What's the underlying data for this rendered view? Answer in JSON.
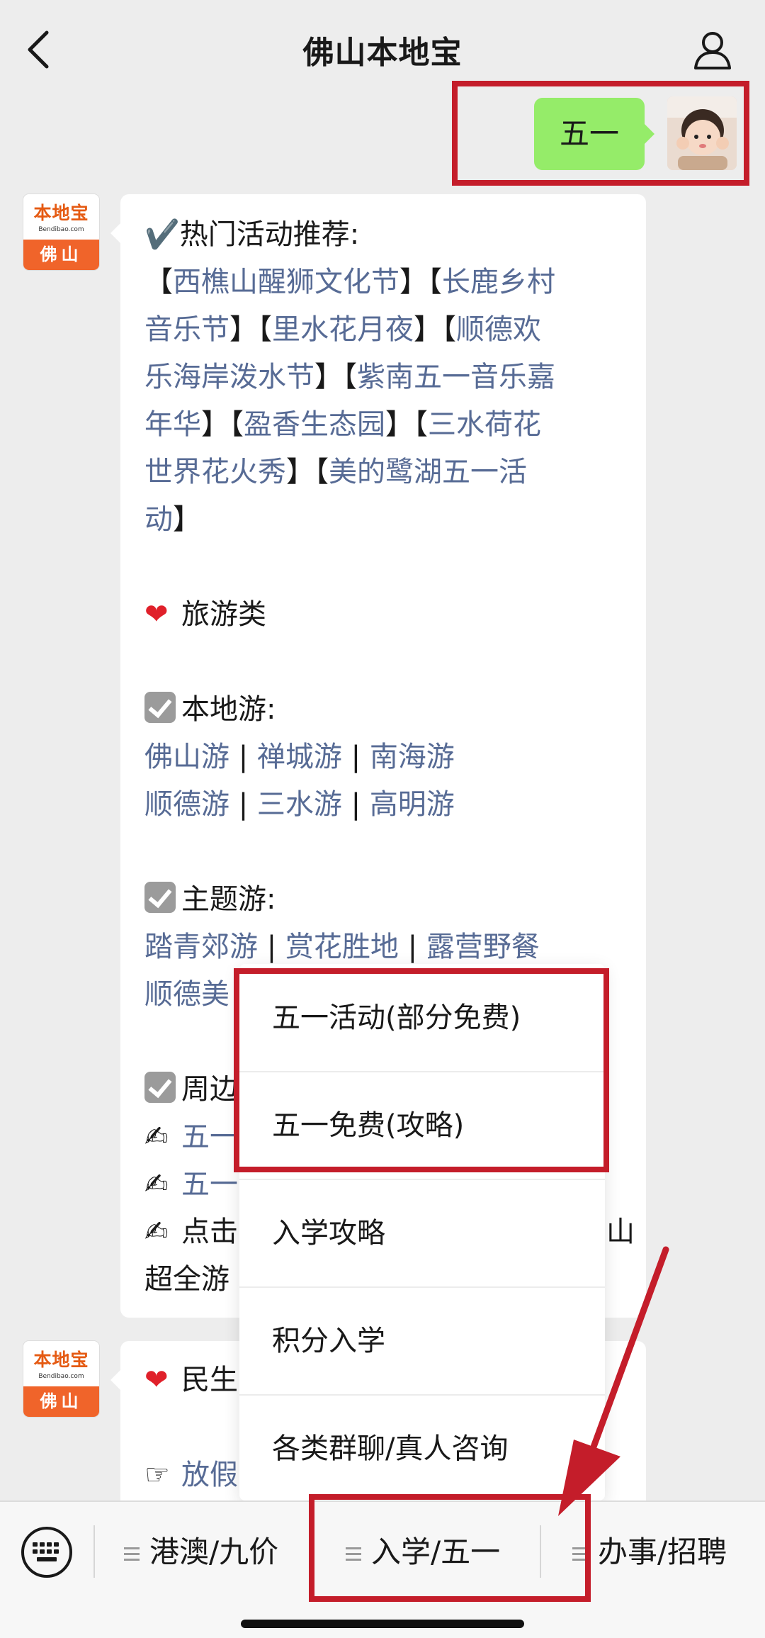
{
  "header": {
    "title": "佛山本地宝"
  },
  "outgoing": {
    "text": "五一"
  },
  "bot": {
    "brand": "本地宝",
    "domain": "Bendibao.com",
    "city": "佛山"
  },
  "message": {
    "hot_prefix": "✔️热门活动推荐:",
    "lines": [
      [
        "【",
        "西樵山醒狮文化节",
        "】【",
        "长鹿乡村"
      ],
      [
        "音乐节",
        "】【",
        "里水花月夜",
        "】【",
        "顺德欢"
      ],
      [
        "乐海岸泼水节",
        "】【",
        "紫南五一音乐嘉"
      ],
      [
        "年华",
        "】【",
        "盈香生态园",
        "】【",
        "三水荷花"
      ],
      [
        "世界花火秀",
        "】【",
        "美的鹭湖五一活"
      ],
      [
        "动",
        "】"
      ]
    ],
    "travel_heading": "旅游类",
    "local_heading": "本地游:",
    "local_row1": [
      "佛山游",
      "禅城游",
      "南海游"
    ],
    "local_row2": [
      "顺德游",
      "三水游",
      "高明游"
    ],
    "theme_heading": "主题游:",
    "theme_row1": [
      "踏青郊游",
      "赏花胜地",
      "露营野餐"
    ],
    "theme_row2_partial": "顺德美",
    "nearby_heading_partial": "周边",
    "writing_line1": "五一",
    "writing_line2": "五一",
    "writing_line3": "点击",
    "writing_line3_tail": "山",
    "last_line_partial": "超全游",
    "separator": " | "
  },
  "message2": {
    "line1_partial": "民生",
    "line2_partial": "放假"
  },
  "popup_menu": {
    "items": [
      "五一活动(部分免费)",
      "五一免费(攻略)",
      "入学攻略",
      "积分入学",
      "各类群聊/真人咨询"
    ]
  },
  "bottom_menu": {
    "tabs": [
      "港澳/九价",
      "入学/五一",
      "办事/招聘"
    ]
  },
  "colors": {
    "link": "#576b95",
    "outgoing_bubble": "#95ec69",
    "highlight": "#c41d2a",
    "brand_orange": "#f0642a"
  }
}
